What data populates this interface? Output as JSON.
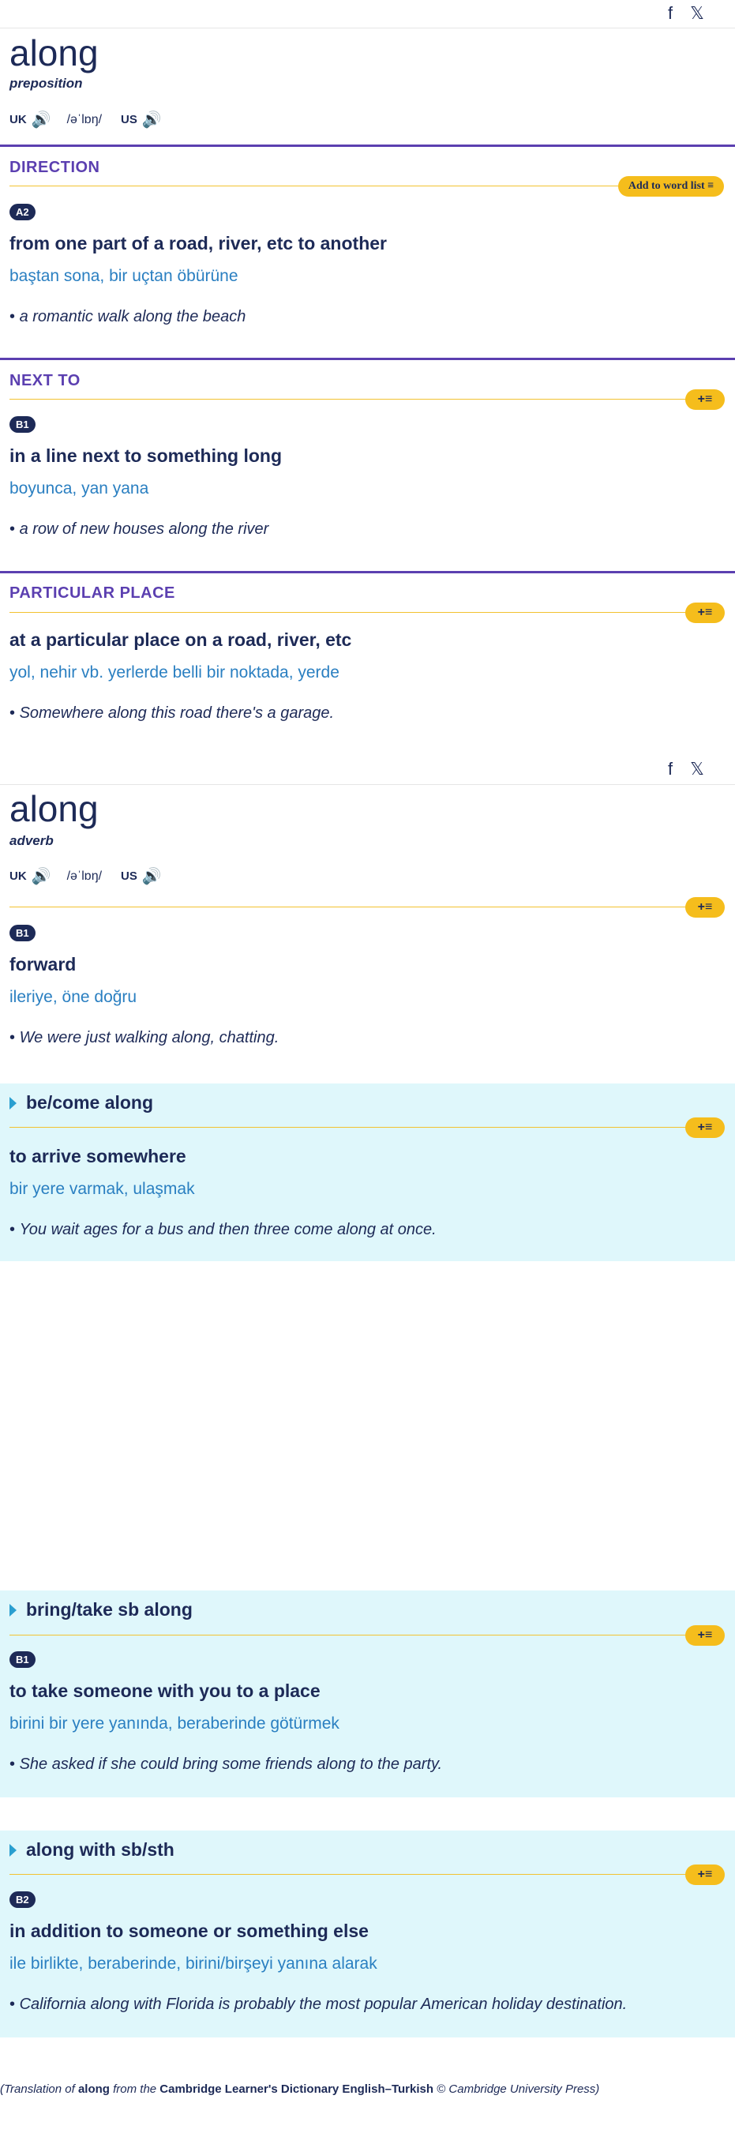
{
  "share": {
    "facebook_icon": "f",
    "x_icon": "𝕏"
  },
  "entry1": {
    "headword": "along",
    "pos": "preposition",
    "uk_label": "UK",
    "ipa": "/əˈlɒŋ/",
    "us_label": "US",
    "add_to_word_list": "Add to word list",
    "senses": [
      {
        "guideword": "DIRECTION",
        "level": "A2",
        "definition": "from one part of a road, river, etc to another",
        "translation": "baştan sona, bir uçtan öbürüne",
        "example": "a romantic walk along the beach"
      },
      {
        "guideword": "NEXT TO",
        "level": "B1",
        "definition": "in a line next to something long",
        "translation": "boyunca, yan yana",
        "example": "a row of new houses along the river"
      },
      {
        "guideword": "PARTICULAR PLACE",
        "definition": "at a particular place on a road, river, etc",
        "translation": "yol, nehir vb. yerlerde belli bir noktada, yerde",
        "example": "Somewhere along this road there's a garage."
      }
    ]
  },
  "entry2": {
    "headword": "along",
    "pos": "adverb",
    "uk_label": "UK",
    "ipa": "/əˈlɒŋ/",
    "us_label": "US",
    "sense": {
      "level": "B1",
      "definition": "forward",
      "translation": "ileriye, öne doğru",
      "example": "We were just walking along, chatting."
    },
    "phrases": [
      {
        "title": "be/come along",
        "definition": "to arrive somewhere",
        "translation": "bir yere varmak, ulaşmak",
        "example": "You wait ages for a bus and then three come along at once."
      },
      {
        "title": "bring/take sb along",
        "level": "B1",
        "definition": "to take someone with you to a place",
        "translation": "birini bir yere yanında, beraberinde götürmek",
        "example": "She asked if she could bring some friends along to the party."
      },
      {
        "title": "along with sb/sth",
        "level": "B2",
        "definition": "in addition to someone or something else",
        "translation": "ile birlikte, beraberinde, birini/birşeyi yanına alarak",
        "example": "California along with Florida is probably the most popular American holiday destination."
      }
    ]
  },
  "footer": {
    "prefix": "(Translation of ",
    "word": "along",
    "middle": " from the ",
    "dictionary": "Cambridge Learner's Dictionary English–Turkish",
    "suffix": " © Cambridge University Press)"
  },
  "icons": {
    "speaker": "🔊",
    "plus_list": "+≡"
  }
}
